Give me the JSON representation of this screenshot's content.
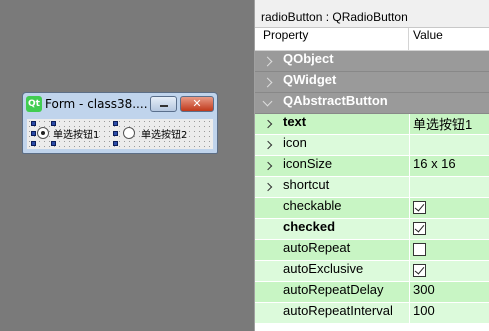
{
  "form": {
    "logo": "Qt",
    "title": "Form - class38....",
    "close_glyph": "✕",
    "radio1_label": "单选按钮1",
    "radio2_label": "单选按钮2"
  },
  "property_editor": {
    "header": "radioButton : QRadioButton",
    "col_property": "Property",
    "col_value": "Value",
    "categories": [
      "QObject",
      "QWidget",
      "QAbstractButton"
    ],
    "props": {
      "text": {
        "name": "text",
        "value": "单选按钮1"
      },
      "icon": {
        "name": "icon",
        "value": ""
      },
      "iconSize": {
        "name": "iconSize",
        "value": "16 x 16"
      },
      "shortcut": {
        "name": "shortcut",
        "value": ""
      },
      "checkable": {
        "name": "checkable",
        "checked": true
      },
      "checked": {
        "name": "checked",
        "checked": true
      },
      "autoRepeat": {
        "name": "autoRepeat",
        "checked": false
      },
      "autoExclusive": {
        "name": "autoExclusive",
        "checked": true
      },
      "autoRepeatDelay": {
        "name": "autoRepeatDelay",
        "value": "300"
      },
      "autoRepeatInterval": {
        "name": "autoRepeatInterval",
        "value": "100"
      }
    }
  },
  "colors": {
    "row_green": "#c8f5c4",
    "row_green_light": "#dcfadb",
    "category_gray": "#9a9a9a"
  }
}
